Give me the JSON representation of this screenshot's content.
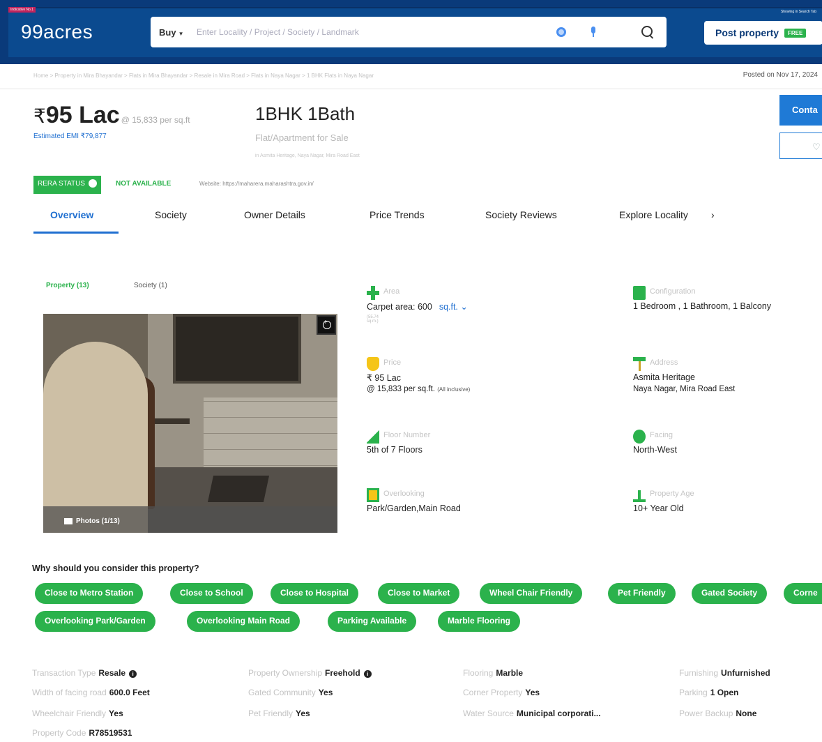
{
  "header": {
    "tag": "Indicative No.1",
    "right_note": "Showing in Search Tab",
    "logo": "99acres",
    "buy_label": "Buy",
    "search_placeholder": "Enter Locality / Project / Society / Landmark",
    "post_label": "Post property",
    "post_badge": "FREE"
  },
  "breadcrumb": {
    "path": "Home > Property in Mira Bhayandar > Flats in Mira Bhayandar > Resale in Mira Road > Flats in Naya Nagar > 1 BHK Flats in Naya Nagar",
    "posted": "Posted on Nov 17, 2024"
  },
  "summary": {
    "currency": "₹",
    "price": "95 Lac",
    "per_sqft": "@ 15,833 per sq.ft",
    "emi": "Estimated EMI ₹79,877",
    "title": "1BHK 1Bath",
    "subtitle": "Flat/Apartment for Sale",
    "address_line": "in Asmita Heritage, Naya Nagar, Mira Road East",
    "contact_label": "Conta"
  },
  "rera": {
    "label": "RERA STATUS",
    "status": "NOT AVAILABLE",
    "website": "Website: https://maharera.maharashtra.gov.in/"
  },
  "tabs": [
    "Overview",
    "Society",
    "Owner Details",
    "Price Trends",
    "Society Reviews",
    "Explore Locality"
  ],
  "tabs_arrow": "›",
  "gallery": {
    "tab_property": "Property (13)",
    "tab_society": "Society (1)",
    "photos_label": "Photos (1/13)"
  },
  "details": {
    "area": {
      "label": "Area",
      "value": "Carpet area: 600",
      "unit": "sq.ft. ⌄",
      "conv": "(55.74 sq.m.)"
    },
    "configuration": {
      "label": "Configuration",
      "value": "1 Bedroom , 1 Bathroom, 1 Balcony"
    },
    "price": {
      "label": "Price",
      "value": "₹ 95 Lac",
      "sub": "@ 15,833 per sq.ft.",
      "sub_note": "(All inclusive)"
    },
    "address": {
      "label": "Address",
      "value": "Asmita Heritage",
      "sub": "Naya Nagar, Mira Road East"
    },
    "floor": {
      "label": "Floor Number",
      "value": "5th  of 7 Floors"
    },
    "facing": {
      "label": "Facing",
      "value": "North-West"
    },
    "overlooking": {
      "label": "Overlooking",
      "value": "Park/Garden,Main Road"
    },
    "age": {
      "label": "Property Age",
      "value": "10+ Year Old"
    }
  },
  "why": {
    "title": "Why should you consider this property?",
    "chips_row1": [
      "Close to Metro Station",
      "Close to School",
      "Close to Hospital",
      "Close to Market",
      "Wheel Chair Friendly",
      "Pet Friendly",
      "Gated Society",
      "Corne"
    ],
    "chips_row2": [
      "Overlooking Park/Garden",
      "Overlooking Main Road",
      "Parking Available",
      "Marble Flooring"
    ]
  },
  "facts": [
    {
      "label": "Transaction Type",
      "value": "Resale",
      "info": "i"
    },
    {
      "label": "Property Ownership",
      "value": "Freehold",
      "info": "i"
    },
    {
      "label": "Flooring",
      "value": "Marble"
    },
    {
      "label": "Furnishing",
      "value": "Unfurnished"
    },
    {
      "label": "Width of facing road",
      "value": "600.0 Feet"
    },
    {
      "label": "Gated Community",
      "value": "Yes"
    },
    {
      "label": "Corner Property",
      "value": "Yes"
    },
    {
      "label": "Parking",
      "value": "1 Open"
    },
    {
      "label": "Wheelchair Friendly",
      "value": "Yes"
    },
    {
      "label": "Pet Friendly",
      "value": "Yes"
    },
    {
      "label": "Water Source",
      "value": "Municipal corporati..."
    },
    {
      "label": "Power Backup",
      "value": "None"
    },
    {
      "label": "Property Code",
      "value": "R78519531"
    }
  ],
  "colors": {
    "brand_blue": "#0b4a8f",
    "accent_green": "#2bb24c",
    "link_blue": "#1f6fd0"
  }
}
